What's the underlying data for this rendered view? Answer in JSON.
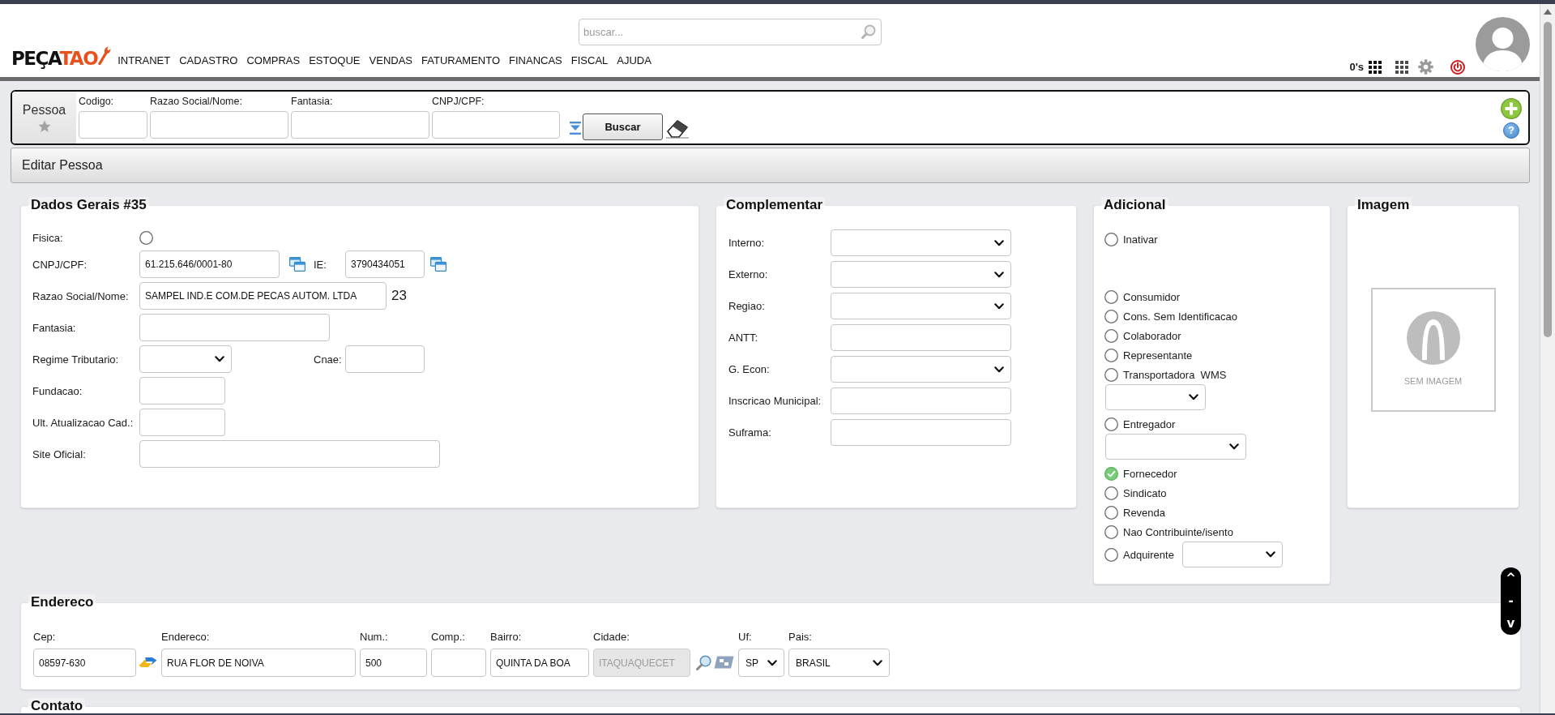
{
  "header": {
    "logo": {
      "dark": "PEÇA",
      "accent": "TAO"
    },
    "nav": [
      "INTRANET",
      "CADASTRO",
      "COMPRAS",
      "ESTOQUE",
      "VENDAS",
      "FATURAMENTO",
      "FINANCAS",
      "FISCAL",
      "AJUDA"
    ],
    "search": {
      "placeholder": "buscar..."
    },
    "counter": "0's"
  },
  "search_panel": {
    "title": "Pessoa",
    "fields": [
      {
        "label": "Codigo:"
      },
      {
        "label": "Razao Social/Nome:"
      },
      {
        "label": "Fantasia:"
      },
      {
        "label": "CNPJ/CPF:"
      }
    ],
    "button": "Buscar",
    "help": "?"
  },
  "edit_bar": {
    "title": "Editar Pessoa"
  },
  "dados_gerais": {
    "title": "Dados Gerais #35",
    "rows": [
      {
        "label": "Fisica:",
        "controls": [
          {
            "kind": "radio",
            "checked": false
          }
        ]
      },
      {
        "label": "CNPJ/CPF:",
        "controls": [
          {
            "kind": "input",
            "value": "61.215.646/0001-80"
          },
          {
            "kind": "copy"
          },
          {
            "kind": "label",
            "text": "IE:"
          },
          {
            "kind": "input",
            "value": "3790434051"
          },
          {
            "kind": "copy"
          }
        ]
      },
      {
        "label": "Razao Social/Nome:",
        "controls": [
          {
            "kind": "input",
            "value": "SAMPEL IND.E COM.DE PECAS AUTOM. LTDA"
          },
          {
            "kind": "counter",
            "text": "23"
          }
        ]
      },
      {
        "label": "Fantasia:",
        "controls": [
          {
            "kind": "input"
          }
        ]
      },
      {
        "label": "Regime Tributario:",
        "controls": [
          {
            "kind": "select"
          },
          {
            "kind": "label",
            "text": "Cnae:"
          },
          {
            "kind": "input"
          }
        ]
      },
      {
        "label": "Fundacao:",
        "controls": [
          {
            "kind": "input"
          }
        ]
      },
      {
        "label": "Ult. Atualizacao Cad.:",
        "controls": [
          {
            "kind": "input"
          }
        ]
      },
      {
        "label": "Site Oficial:",
        "controls": [
          {
            "kind": "input"
          }
        ]
      }
    ]
  },
  "complementar": {
    "title": "Complementar",
    "rows": [
      {
        "label": "Interno:",
        "kind": "select"
      },
      {
        "label": "Externo:",
        "kind": "select"
      },
      {
        "label": "Regiao:",
        "kind": "select"
      },
      {
        "label": "ANTT:",
        "kind": "input"
      },
      {
        "label": "G. Econ:",
        "kind": "select"
      },
      {
        "label": "Inscricao Municipal:",
        "kind": "input"
      },
      {
        "label": "Suframa:",
        "kind": "input"
      }
    ]
  },
  "adicional": {
    "title": "Adicional",
    "items": [
      {
        "kind": "radio",
        "label": "Inativar",
        "checked": false
      },
      {
        "kind": "radio",
        "label": "Consumidor",
        "checked": false
      },
      {
        "kind": "radio",
        "label": "Cons. Sem Identificacao",
        "checked": false
      },
      {
        "kind": "radio",
        "label": "Colaborador",
        "checked": false
      },
      {
        "kind": "radio",
        "label": "Representante",
        "checked": false
      },
      {
        "kind": "radio",
        "label": "Transportadora  WMS",
        "checked": false
      },
      {
        "kind": "select"
      },
      {
        "kind": "radio",
        "label": "Entregador",
        "checked": false
      },
      {
        "kind": "select"
      },
      {
        "kind": "radio",
        "label": "Fornecedor",
        "checked": true
      },
      {
        "kind": "radio",
        "label": "Sindicato",
        "checked": false
      },
      {
        "kind": "radio",
        "label": "Revenda",
        "checked": false
      },
      {
        "kind": "radio",
        "label": "Nao Contribuinte/isento",
        "checked": false
      },
      {
        "kind": "radio_select",
        "label": "Adquirente",
        "checked": false
      }
    ]
  },
  "imagem": {
    "title": "Imagem",
    "placeholder_text": "SEM IMAGEM"
  },
  "endereco": {
    "title": "Endereco",
    "fields": [
      {
        "label": "Cep:",
        "kind": "input",
        "value": "08597-630",
        "disabled": false
      },
      {
        "label": "Endereco:",
        "kind": "input",
        "value": "RUA FLOR DE NOIVA",
        "disabled": false
      },
      {
        "label": "Num.:",
        "kind": "input",
        "value": "500",
        "disabled": false
      },
      {
        "label": "Comp.:",
        "kind": "input",
        "disabled": false
      },
      {
        "label": "Bairro:",
        "kind": "input",
        "value": "QUINTA DA BOA",
        "disabled": false
      },
      {
        "label": "Cidade:",
        "kind": "input",
        "value": "ITAQUAQUECET",
        "disabled": true
      },
      {
        "label": "Uf:",
        "kind": "select",
        "value": "SP",
        "disabled": false
      },
      {
        "label": "Pais:",
        "kind": "select",
        "value": "BRASIL",
        "disabled": false
      }
    ]
  },
  "contato": {
    "title": "Contato"
  },
  "scroll_nav": {
    "up": "^",
    "middle": "-",
    "down": "v"
  }
}
